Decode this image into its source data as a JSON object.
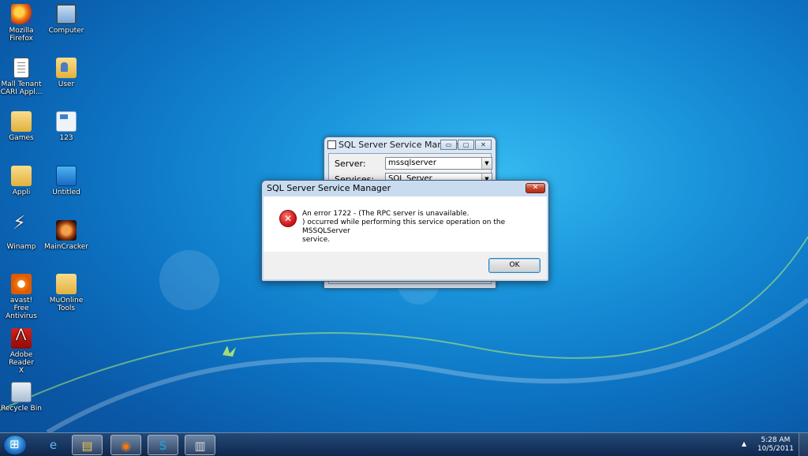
{
  "desktop_icons": [
    {
      "label": "Mozilla Firefox",
      "icon": "firefox-icon"
    },
    {
      "label": "Computer",
      "icon": "computer-icon"
    },
    {
      "label": "Mall Tenant CARI Appl...",
      "icon": "document-icon"
    },
    {
      "label": "User",
      "icon": "user-folder-icon"
    },
    {
      "label": "Games",
      "icon": "folder-icon"
    },
    {
      "label": "123",
      "icon": "card-icon"
    },
    {
      "label": "Appli",
      "icon": "folder-icon"
    },
    {
      "label": "Untitled",
      "icon": "image-icon"
    },
    {
      "label": "Winamp",
      "icon": "winamp-icon"
    },
    {
      "label": "MainCracker",
      "icon": "maincracker-icon"
    },
    {
      "label": "avast! Free Antivirus",
      "icon": "avast-icon"
    },
    {
      "label": "MuOnline Tools",
      "icon": "folder-icon"
    },
    {
      "label": "Adobe Reader X",
      "icon": "adobe-reader-icon"
    },
    {
      "label": "Recycle Bin",
      "icon": "recycle-bin-icon"
    }
  ],
  "back_window": {
    "title": "SQL Server Service Manager",
    "server_label": "Server:",
    "server_value": "mssqlserver",
    "services_label": "Services:",
    "services_value": "SQL Server",
    "controls": [
      "▭",
      "▢",
      "✕"
    ]
  },
  "dialog": {
    "title": "SQL Server Service Manager",
    "close_glyph": "✕",
    "error_glyph": "✕",
    "message_line1": "An error 1722 - (The RPC server is unavailable.",
    "message_line2": ") occurred while performing this service operation on the MSSQLServer",
    "message_line3": "service.",
    "ok_label": "OK"
  },
  "taskbar": {
    "buttons": [
      {
        "name": "internet-explorer",
        "glyph": "e"
      },
      {
        "name": "windows-explorer",
        "glyph": "▤"
      },
      {
        "name": "firefox",
        "glyph": "◉"
      },
      {
        "name": "skype",
        "glyph": "S"
      },
      {
        "name": "sql-service-manager",
        "glyph": "▥"
      }
    ],
    "tray_arrow": "▲",
    "time": "5:28 AM",
    "date": "10/5/2011"
  },
  "colors": {
    "desktop_blue": "#1a95dc",
    "dialog_frame": "#c9dbef",
    "error_red": "#d4171b"
  }
}
